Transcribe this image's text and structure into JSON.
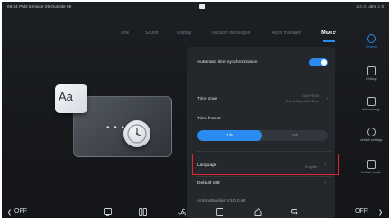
{
  "status_bar": {
    "left_text": "09:34  PM2.5 Inside 29  Outside 09",
    "right_text": "4.0  ⚠  43m  ⚠  0"
  },
  "tabs": [
    {
      "label": "Link",
      "active": false
    },
    {
      "label": "Sound",
      "active": false
    },
    {
      "label": "Display",
      "active": false
    },
    {
      "label": "Vacation messages",
      "active": false
    },
    {
      "label": "Apps manager",
      "active": false
    },
    {
      "label": "More",
      "active": true
    }
  ],
  "illustration": {
    "card_text": "Aa",
    "dots": "• • •"
  },
  "settings": {
    "auto_time_sync": {
      "label": "Automatic time synchronization",
      "enabled": true
    },
    "time_zone": {
      "label": "Time zone",
      "value_line1": "GMT+8:00",
      "value_line2": "China Standard Time"
    },
    "time_format": {
      "label": "Time format",
      "options": [
        "12h",
        "24h"
      ],
      "selected": "12h"
    },
    "language": {
      "label": "Language",
      "value": "English"
    },
    "default_ime": {
      "label": "Default IME"
    },
    "android_version": {
      "label": "AndroidBuilder:V1.0.0.08"
    }
  },
  "sidebar": {
    "items": [
      {
        "label": "System",
        "icon": "system-icon",
        "active": true
      },
      {
        "label": "Defkey",
        "icon": "defkey-icon",
        "active": false
      },
      {
        "label": "New energy",
        "icon": "new-energy-icon",
        "active": false
      },
      {
        "label": "Vehicle settings",
        "icon": "vehicle-settings-icon",
        "active": false
      },
      {
        "label": "Vehicle health",
        "icon": "vehicle-health-icon",
        "active": false
      }
    ]
  },
  "bottom_bar": {
    "left_status": "OFF",
    "right_status": "OFF"
  },
  "colors": {
    "accent": "#2b8cf0",
    "highlight": "#e0262e",
    "background": "#16181c",
    "panel": "#24272c"
  }
}
